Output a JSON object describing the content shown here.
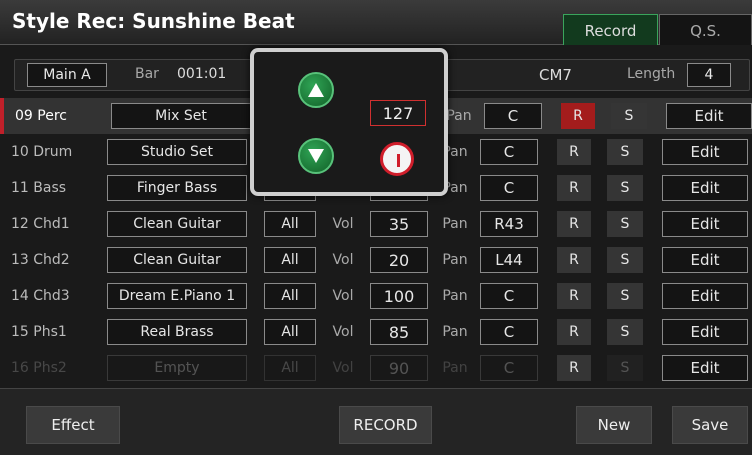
{
  "header": {
    "title": "Style Rec: Sunshine Beat",
    "tabs": [
      {
        "label": "Record",
        "active": true
      },
      {
        "label": "Q.S.",
        "active": false
      }
    ]
  },
  "infobar": {
    "section": "Main A",
    "bar_label": "Bar",
    "bar_value": "001:01",
    "chord": "CM7",
    "length_label": "Length",
    "length_value": "4"
  },
  "labels": {
    "vol": "Vol",
    "pan": "Pan",
    "r": "R",
    "s": "S",
    "edit": "Edit"
  },
  "tracks": [
    {
      "name": "09 Perc",
      "voice": "Mix Set",
      "part": "",
      "vol": "127",
      "pan": "C",
      "r_on": true,
      "enabled": true
    },
    {
      "name": "10 Drum",
      "voice": "Studio Set",
      "part": "",
      "vol": "",
      "pan": "C",
      "r_on": false,
      "enabled": true
    },
    {
      "name": "11 Bass",
      "voice": "Finger Bass",
      "part": "",
      "vol": "",
      "pan": "C",
      "r_on": false,
      "enabled": true
    },
    {
      "name": "12 Chd1",
      "voice": "Clean Guitar",
      "part": "All",
      "vol": "35",
      "pan": "R43",
      "r_on": false,
      "enabled": true
    },
    {
      "name": "13 Chd2",
      "voice": "Clean Guitar",
      "part": "All",
      "vol": "20",
      "pan": "L44",
      "r_on": false,
      "enabled": true
    },
    {
      "name": "14 Chd3",
      "voice": "Dream E.Piano 1",
      "part": "All",
      "vol": "100",
      "pan": "C",
      "r_on": false,
      "enabled": true
    },
    {
      "name": "15 Phs1",
      "voice": "Real Brass",
      "part": "All",
      "vol": "85",
      "pan": "C",
      "r_on": false,
      "enabled": true
    },
    {
      "name": "16 Phs2",
      "voice": "Empty",
      "part": "All",
      "vol": "90",
      "pan": "C",
      "r_on": false,
      "enabled": false
    }
  ],
  "footer": {
    "effect": "Effect",
    "record": "RECORD",
    "new": "New",
    "save": "Save"
  },
  "popup": {
    "value": "127",
    "up_icon": "triangle-up-icon",
    "down_icon": "triangle-down-icon",
    "knob_icon": "knob-icon"
  },
  "colors": {
    "accent_red": "#c0202a",
    "accent_green": "#2fa455"
  }
}
